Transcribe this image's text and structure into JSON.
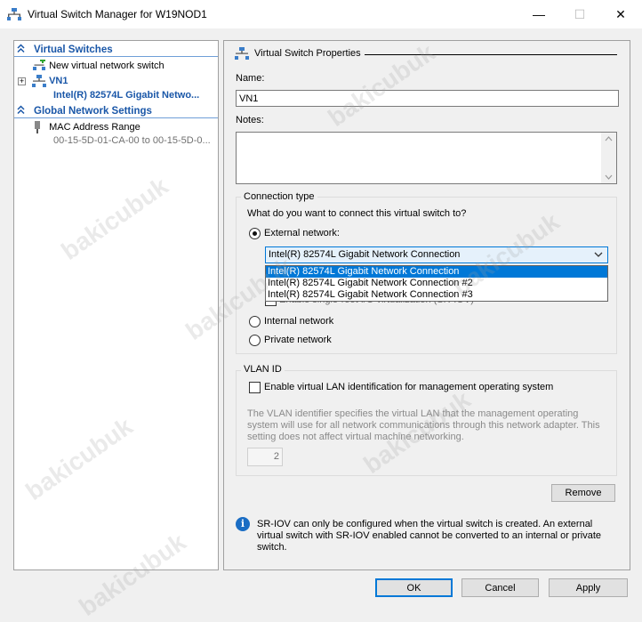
{
  "window": {
    "title": "Virtual Switch Manager for W19NOD1",
    "controls": {
      "minimize": "—",
      "maximize": "☐",
      "close": "✕"
    }
  },
  "tree": {
    "virtual_switches_header": "Virtual Switches",
    "new_switch": "New virtual network switch",
    "expand_glyph": "+",
    "vn1_name": "VN1",
    "vn1_adapter": "Intel(R) 82574L Gigabit Netwo...",
    "global_header": "Global Network Settings",
    "mac_title": "MAC Address Range",
    "mac_value": "00-15-5D-01-CA-00 to 00-15-5D-0..."
  },
  "props": {
    "section_title": "Virtual Switch Properties",
    "name_label": "Name:",
    "name_value": "VN1",
    "notes_label": "Notes:",
    "notes_value": "",
    "connection_type_title": "Connection type",
    "connection_question": "What do you want to connect this virtual switch to?",
    "external_label": "External network:",
    "dropdown_selected": "Intel(R) 82574L Gigabit Network Connection",
    "dropdown_options": [
      "Intel(R) 82574L Gigabit Network Connection",
      "Intel(R) 82574L Gigabit Network Connection #2",
      "Intel(R) 82574L Gigabit Network Connection #3"
    ],
    "sriov_partial": "Enable single-root I/O virtualization (SR-IOV)",
    "internal_label": "Internal network",
    "private_label": "Private network",
    "vlan_title": "VLAN ID",
    "vlan_checkbox_label": "Enable virtual LAN identification for management operating system",
    "vlan_description_1": "The VLAN identifier specifies the virtual LAN that the management operating",
    "vlan_description_2": "system will use for all network communications through this network adapter. This",
    "vlan_description_3": "setting does not affect virtual machine networking.",
    "vlan_value": "2",
    "remove_label": "Remove",
    "info_glyph": "i",
    "info_line_1": "SR-IOV can only be configured when the virtual switch is created. An external",
    "info_line_2": "virtual switch with SR-IOV enabled cannot be converted to an internal or private",
    "info_line_3": "switch."
  },
  "footer": {
    "ok_label": "OK",
    "cancel_label": "Cancel",
    "apply_label": "Apply"
  },
  "watermark": "bakicubuk",
  "colors": {
    "accent": "#0078d7",
    "tree_header": "#1a57a8",
    "selection": "#0078d7"
  }
}
